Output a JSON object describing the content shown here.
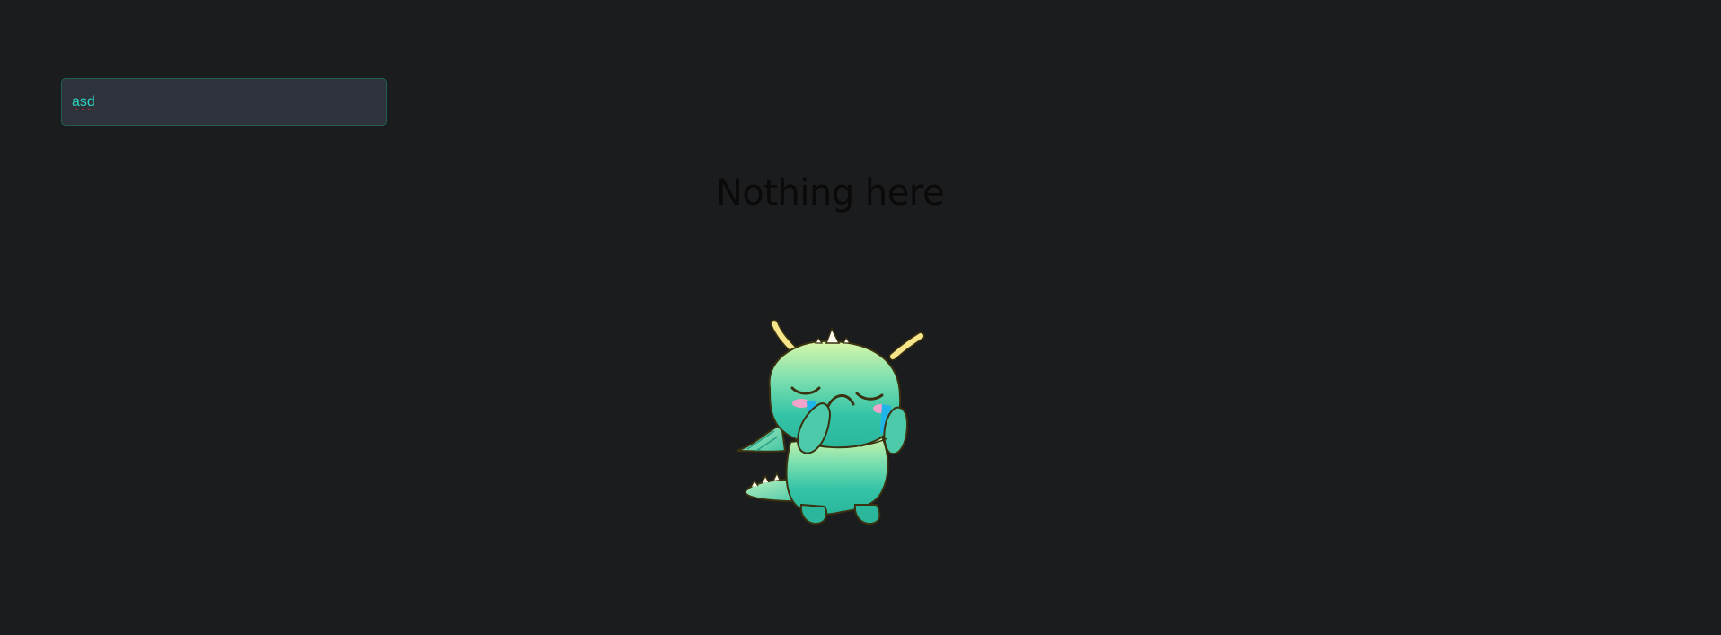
{
  "search": {
    "value": "asd"
  },
  "empty_state": {
    "title": "Nothing here",
    "illustration": "crying-dragon-mascot"
  },
  "colors": {
    "background": "#1b1c1e",
    "input_background": "#2e323a",
    "input_border": "#1f5f54",
    "input_text": "#2ad4bf",
    "title_text": "#0a0a0a"
  }
}
